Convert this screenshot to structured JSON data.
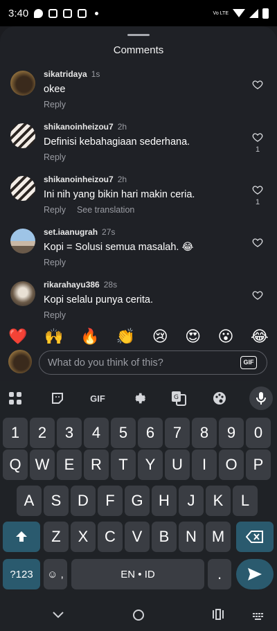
{
  "status_bar": {
    "time": "3:40",
    "network_label": "Vo LTE",
    "icons": [
      "chat-icon",
      "tablet-icon",
      "instagram-icon",
      "instagram-icon",
      "dot-icon",
      "wifi-icon",
      "signal-icon",
      "battery-icon"
    ]
  },
  "sheet": {
    "title": "Comments"
  },
  "comments": [
    {
      "user": "sikatridaya",
      "time": "1s",
      "text": "okee",
      "reply": "Reply",
      "translate": "",
      "likes": ""
    },
    {
      "user": "shikanoinheizou7",
      "time": "2h",
      "text": "Definisi kebahagiaan sederhana.",
      "reply": "Reply",
      "translate": "",
      "likes": "1"
    },
    {
      "user": "shikanoinheizou7",
      "time": "2h",
      "text": "Ini nih yang bikin hari makin ceria.",
      "reply": "Reply",
      "translate": "See translation",
      "likes": "1"
    },
    {
      "user": "set.iaanugrah",
      "time": "27s",
      "text": "Kopi = Solusi semua masalah. 😂",
      "reply": "Reply",
      "translate": "",
      "likes": ""
    },
    {
      "user": "rikarahayu386",
      "time": "28s",
      "text": "Kopi selalu punya cerita.",
      "reply": "Reply",
      "translate": "",
      "likes": ""
    }
  ],
  "emoji_reactions": [
    "❤️",
    "🙌",
    "🔥",
    "👏",
    "😢",
    "😍",
    "😮",
    "😂"
  ],
  "input": {
    "placeholder": "What do you think of this?",
    "gif_label": "GIF"
  },
  "keyboard": {
    "toolbar": {
      "gif_label": "GIF",
      "items": [
        "apps-grid-icon",
        "sticker-icon",
        "gif-icon",
        "settings-gear-icon",
        "translate-icon",
        "palette-icon",
        "microphone-icon"
      ]
    },
    "row_numbers": [
      "1",
      "2",
      "3",
      "4",
      "5",
      "6",
      "7",
      "8",
      "9",
      "0"
    ],
    "row_top": [
      "Q",
      "W",
      "E",
      "R",
      "T",
      "Y",
      "U",
      "I",
      "O",
      "P"
    ],
    "row_middle": [
      "A",
      "S",
      "D",
      "F",
      "G",
      "H",
      "J",
      "K",
      "L"
    ],
    "row_bottom": [
      "Z",
      "X",
      "C",
      "V",
      "B",
      "N",
      "M"
    ],
    "symbols_label": "?123",
    "emoji_key_label": "☺ ,",
    "space_label": "EN • ID",
    "period_label": ".",
    "colors": {
      "accent_key": "#2a5a6e",
      "key": "#3a3d43",
      "background": "#1f2226"
    }
  },
  "nav_bar": {
    "items": [
      "back-chevron-icon",
      "home-circle-icon",
      "recents-icon",
      "keyboard-switch-icon"
    ]
  },
  "colors": {
    "sheet_background": "#1f2126",
    "muted_text": "#9a9ca3"
  }
}
